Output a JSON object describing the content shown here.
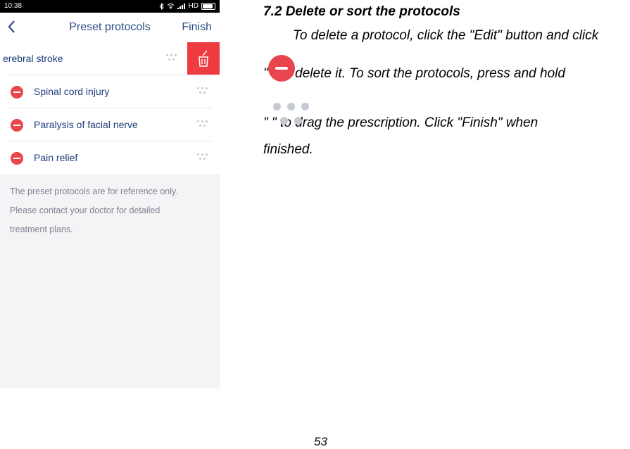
{
  "status_bar": {
    "time": "10:38",
    "network": "HD"
  },
  "nav": {
    "title": "Preset protocols",
    "finish_label": "Finish"
  },
  "protocols": [
    {
      "label": "erebral stroke",
      "swiped": true
    },
    {
      "label": "Spinal cord injury"
    },
    {
      "label": "Paralysis of facial nerve"
    },
    {
      "label": "Pain relief"
    }
  ],
  "note_lines": [
    "The preset protocols are for reference only.",
    "Please contact your doctor for detailed",
    "treatment plans."
  ],
  "doc": {
    "heading": "7.2 Delete or sort the protocols",
    "line1": "To delete a protocol, click the \"Edit\" button and click",
    "line2": "\"   \" to delete it. To sort the protocols, press and hold",
    "line3": "\"          \" to drag the prescription. Click \"Finish\" when",
    "line4": "finished.",
    "page_number": "53"
  },
  "colors": {
    "accent": "#2b4d86",
    "delete": "#ef3c40",
    "minus": "#e8464c"
  }
}
